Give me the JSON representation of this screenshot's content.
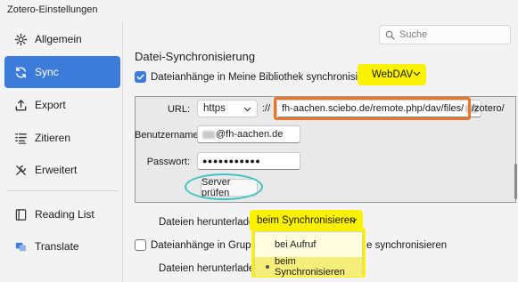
{
  "window": {
    "title": "Zotero-Einstellungen"
  },
  "sidebar": {
    "items": [
      {
        "label": "Allgemein",
        "icon": "gear-icon"
      },
      {
        "label": "Sync",
        "icon": "sync-icon",
        "active": true
      },
      {
        "label": "Export",
        "icon": "export-icon"
      },
      {
        "label": "Zitieren",
        "icon": "cite-icon"
      },
      {
        "label": "Erweitert",
        "icon": "advanced-icon"
      },
      {
        "label": "Reading List",
        "icon": "reading-list-icon"
      },
      {
        "label": "Translate",
        "icon": "translate-icon"
      }
    ]
  },
  "search": {
    "placeholder": "Suche"
  },
  "main": {
    "section_title": "Datei-Synchronisierung",
    "sync_attachments_label": "Dateianhänge in Meine Bibliothek synchronisieren mit",
    "sync_attachments_checked": true,
    "method_value": "WebDAV",
    "url_label": "URL:",
    "protocol_value": "https",
    "protocol_sep": "://",
    "url_value_prefix": "fh-aachen.sciebo.de/remote.php/dav/files/",
    "url_value_suffix": "/zotero/",
    "username_label": "Benutzername:",
    "username_value": "@fh-aachen.de",
    "password_label": "Passwort:",
    "password_value": "●●●●●●●●●●●",
    "verify_button": "Server prüfen",
    "download_label": "Dateien herunterladen",
    "download_value": "beim Synchronisieren",
    "groups_label_part1": "Dateianhänge in Gruppen",
    "groups_label_part2": "e synchronisieren",
    "groups_checked": false,
    "download_label_2": "Dateien herunterladen",
    "download_options": [
      "bei Aufruf",
      "beim Synchronisieren"
    ],
    "download_selected_index": 1
  },
  "colors": {
    "accent": "#3d7bd8",
    "highlight_yellow": "#fbf200",
    "annotation_orange": "#e8762b",
    "annotation_teal": "#3ec4c0"
  }
}
